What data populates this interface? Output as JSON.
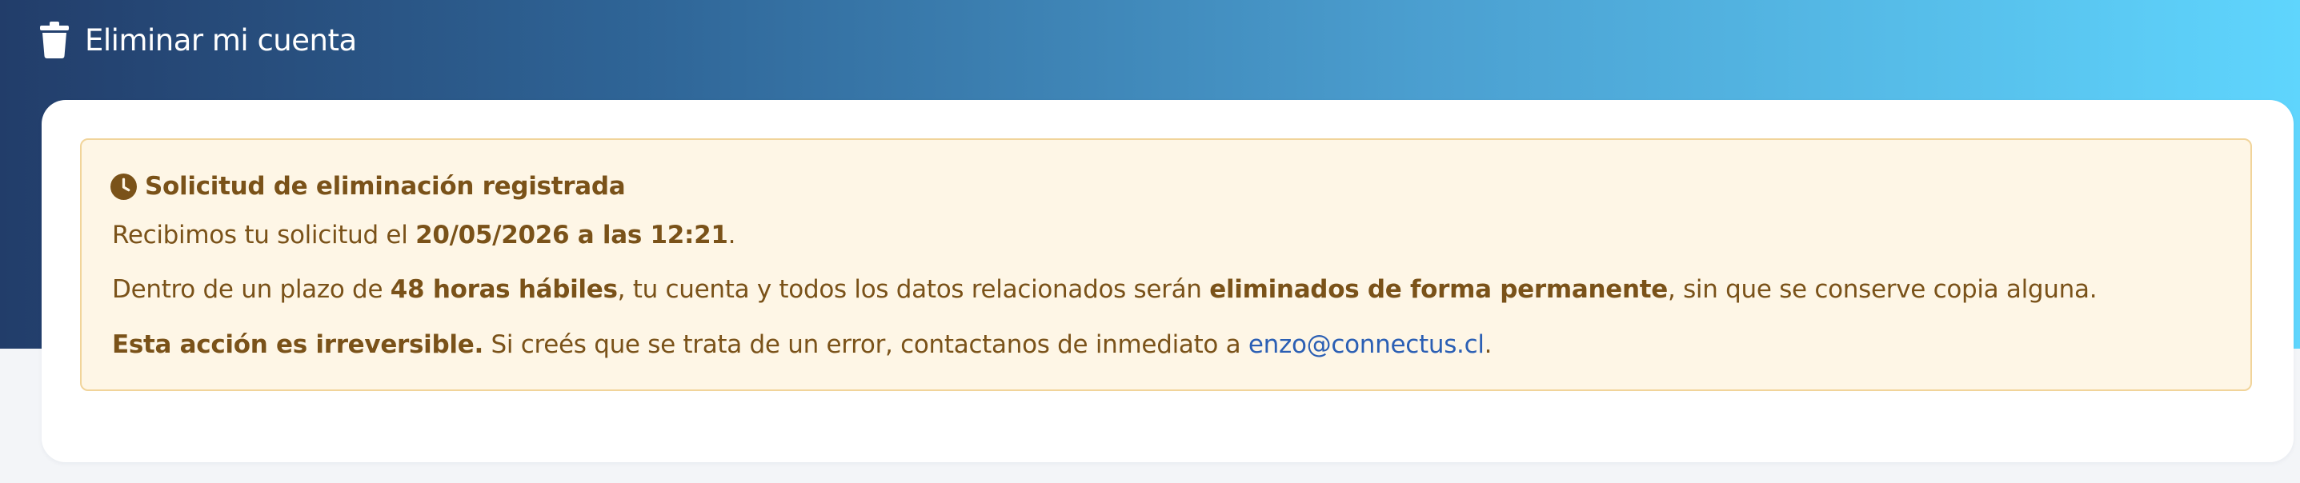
{
  "header": {
    "title": "Eliminar mi cuenta",
    "icon": "trash-icon"
  },
  "alert": {
    "icon": "clock-icon",
    "title": "Solicitud de eliminación registrada",
    "line1": {
      "pre": "Recibimos tu solicitud el ",
      "date": "20/05/2026 a las 12:21",
      "post": "."
    },
    "line2": {
      "pre": "Dentro de un plazo de ",
      "deadline": "48 horas hábiles",
      "mid": ", tu cuenta y todos los datos relacionados serán ",
      "emphasis": "eliminados de forma permanente",
      "post": ", sin que se conserve copia alguna."
    },
    "line3": {
      "warning": "Esta acción es irreversible.",
      "mid": " Si creés que se trata de un error, contactanos de inmediato a ",
      "email": "enzo@connectus.cl",
      "post": "."
    }
  },
  "colors": {
    "gradient_start": "#223d6a",
    "gradient_end": "#5fd5fd",
    "alert_background": "#fef6e6",
    "alert_border": "#f1d49a",
    "alert_text": "#7a5219",
    "link": "#2b5fb4"
  }
}
